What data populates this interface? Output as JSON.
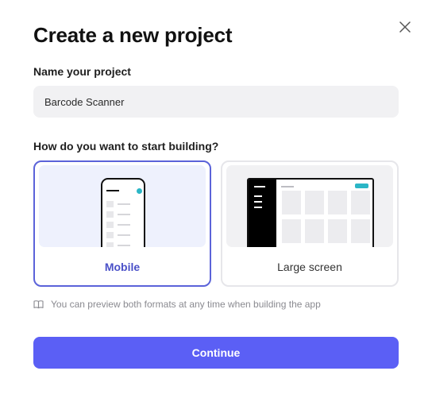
{
  "dialog": {
    "title": "Create a new project",
    "close_icon": "close-icon"
  },
  "name_field": {
    "label": "Name your project",
    "value": "Barcode Scanner"
  },
  "start_building": {
    "label": "How do you want to start building?",
    "selected": "Mobile",
    "options": [
      {
        "label": "Mobile",
        "icon": "phone-preview-icon"
      },
      {
        "label": "Large screen",
        "icon": "desktop-preview-icon"
      }
    ]
  },
  "note": {
    "icon": "book-icon",
    "text": "You can preview both formats at any time when building the app"
  },
  "footer": {
    "continue_label": "Continue"
  },
  "colors": {
    "accent": "#5b5ff5",
    "selected_border": "#5b63d9",
    "teal": "#2bb6c6"
  }
}
